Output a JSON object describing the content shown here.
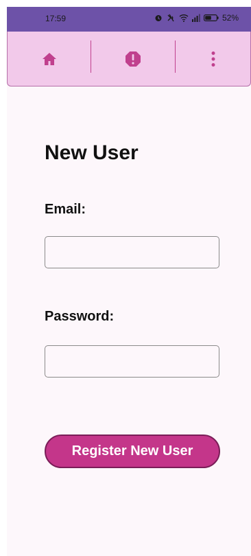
{
  "status_bar": {
    "time": "17:59",
    "battery": "52%",
    "icons": [
      "alarm-icon",
      "vibrate-icon",
      "wifi-icon",
      "signal-icon",
      "battery-icon"
    ]
  },
  "toolbar": {
    "background": "#f2c9ea",
    "accent": "#c0408e",
    "items": [
      "home-icon",
      "alert-octagon-icon",
      "more-vert-icon"
    ]
  },
  "form": {
    "title": "New User",
    "email_label": "Email:",
    "email_value": "",
    "password_label": "Password:",
    "password_value": "",
    "register_label": "Register New User",
    "button_color": "#c4368a"
  }
}
